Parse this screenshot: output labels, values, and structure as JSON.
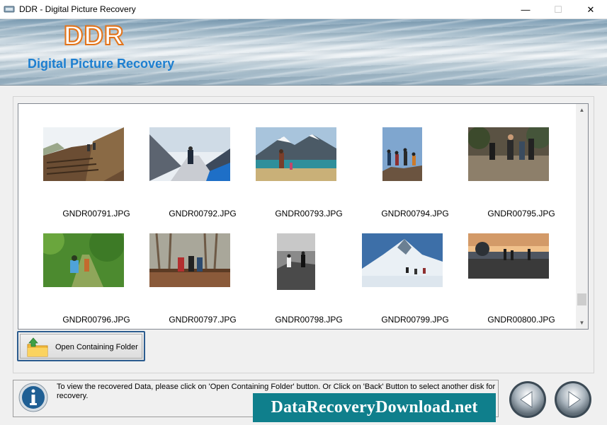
{
  "window": {
    "title": "DDR - Digital Picture Recovery",
    "minimize_glyph": "—",
    "maximize_glyph": "☐",
    "close_glyph": "✕"
  },
  "banner": {
    "logo": "DDR",
    "subtitle": "Digital Picture Recovery"
  },
  "gallery": {
    "items": [
      {
        "filename": "GNDR00791.JPG",
        "icon": "photo-hikers-stairs"
      },
      {
        "filename": "GNDR00792.JPG",
        "icon": "photo-snow-bridge"
      },
      {
        "filename": "GNDR00793.JPG",
        "icon": "photo-mountain-lake"
      },
      {
        "filename": "GNDR00794.JPG",
        "icon": "photo-climbers-peak"
      },
      {
        "filename": "GNDR00795.JPG",
        "icon": "photo-forest-hikers"
      },
      {
        "filename": "GNDR00796.JPG",
        "icon": "photo-green-trail"
      },
      {
        "filename": "GNDR00797.JPG",
        "icon": "photo-wood-bridge"
      },
      {
        "filename": "GNDR00798.JPG",
        "icon": "photo-bw-rocks"
      },
      {
        "filename": "GNDR00799.JPG",
        "icon": "photo-snow-peak"
      },
      {
        "filename": "GNDR00800.JPG",
        "icon": "photo-sunset-walk"
      }
    ]
  },
  "folder_button": {
    "label": "Open Containing Folder",
    "icon": "folder-upload-icon"
  },
  "status": {
    "message": "To view the recovered Data, please click on 'Open Containing Folder' button. Or Click on 'Back' Button to select another disk for recovery."
  },
  "watermark": {
    "text": "DataRecoveryDownload.net"
  },
  "navigation": {
    "back_icon": "back-arrow-icon",
    "next_icon": "next-arrow-icon"
  },
  "colors": {
    "accent_blue": "#1d7fd0",
    "logo_orange": "#e2731a",
    "watermark_teal": "#0f7f8c",
    "button_border": "#2c5c8f"
  }
}
